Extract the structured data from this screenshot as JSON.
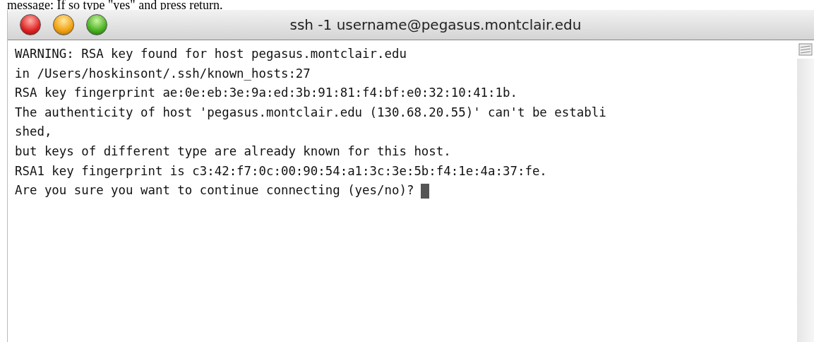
{
  "caption": "message: If so type \"yes\" and press return.",
  "window": {
    "title": "ssh -1 username@pegasus.montclair.edu"
  },
  "terminal": {
    "lines": [
      "WARNING: RSA key found for host pegasus.montclair.edu",
      "in /Users/hoskinsont/.ssh/known_hosts:27",
      "RSA key fingerprint ae:0e:eb:3e:9a:ed:3b:91:81:f4:bf:e0:32:10:41:1b.",
      "The authenticity of host 'pegasus.montclair.edu (130.68.20.55)' can't be establi",
      "shed,",
      "but keys of different type are already known for this host.",
      "RSA1 key fingerprint is c3:42:f7:0c:00:90:54:a1:3c:3e:5b:f4:1e:4a:37:fe.",
      "Are you sure you want to continue connecting (yes/no)?"
    ]
  }
}
